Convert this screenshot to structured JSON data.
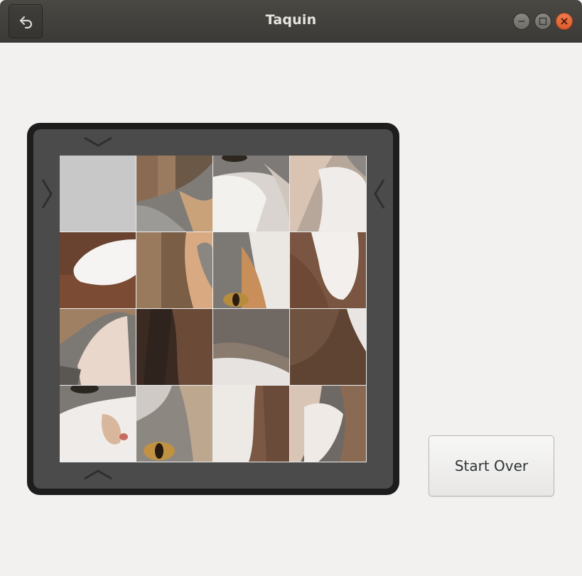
{
  "window": {
    "title": "Taquin",
    "controls": {
      "minimize_icon": "minimize-icon",
      "maximize_icon": "maximize-icon",
      "close_icon": "close-icon"
    }
  },
  "header": {
    "back_icon": "undo-arrow-icon"
  },
  "board": {
    "rows": 4,
    "cols": 4,
    "empty_tile": {
      "row": 0,
      "col": 0
    },
    "move_arrows": [
      "arrow-down",
      "arrow-right",
      "arrow-left",
      "arrow-up"
    ]
  },
  "actions": {
    "start_over_label": "Start Over"
  },
  "colors": {
    "headerbar": "#3f3e3a",
    "background": "#f2f1f0",
    "board_frame": "#1d1d1d",
    "board_inner": "#4b4b4b",
    "close_button": "#e95420",
    "empty_tile": "#c8c8c8"
  }
}
